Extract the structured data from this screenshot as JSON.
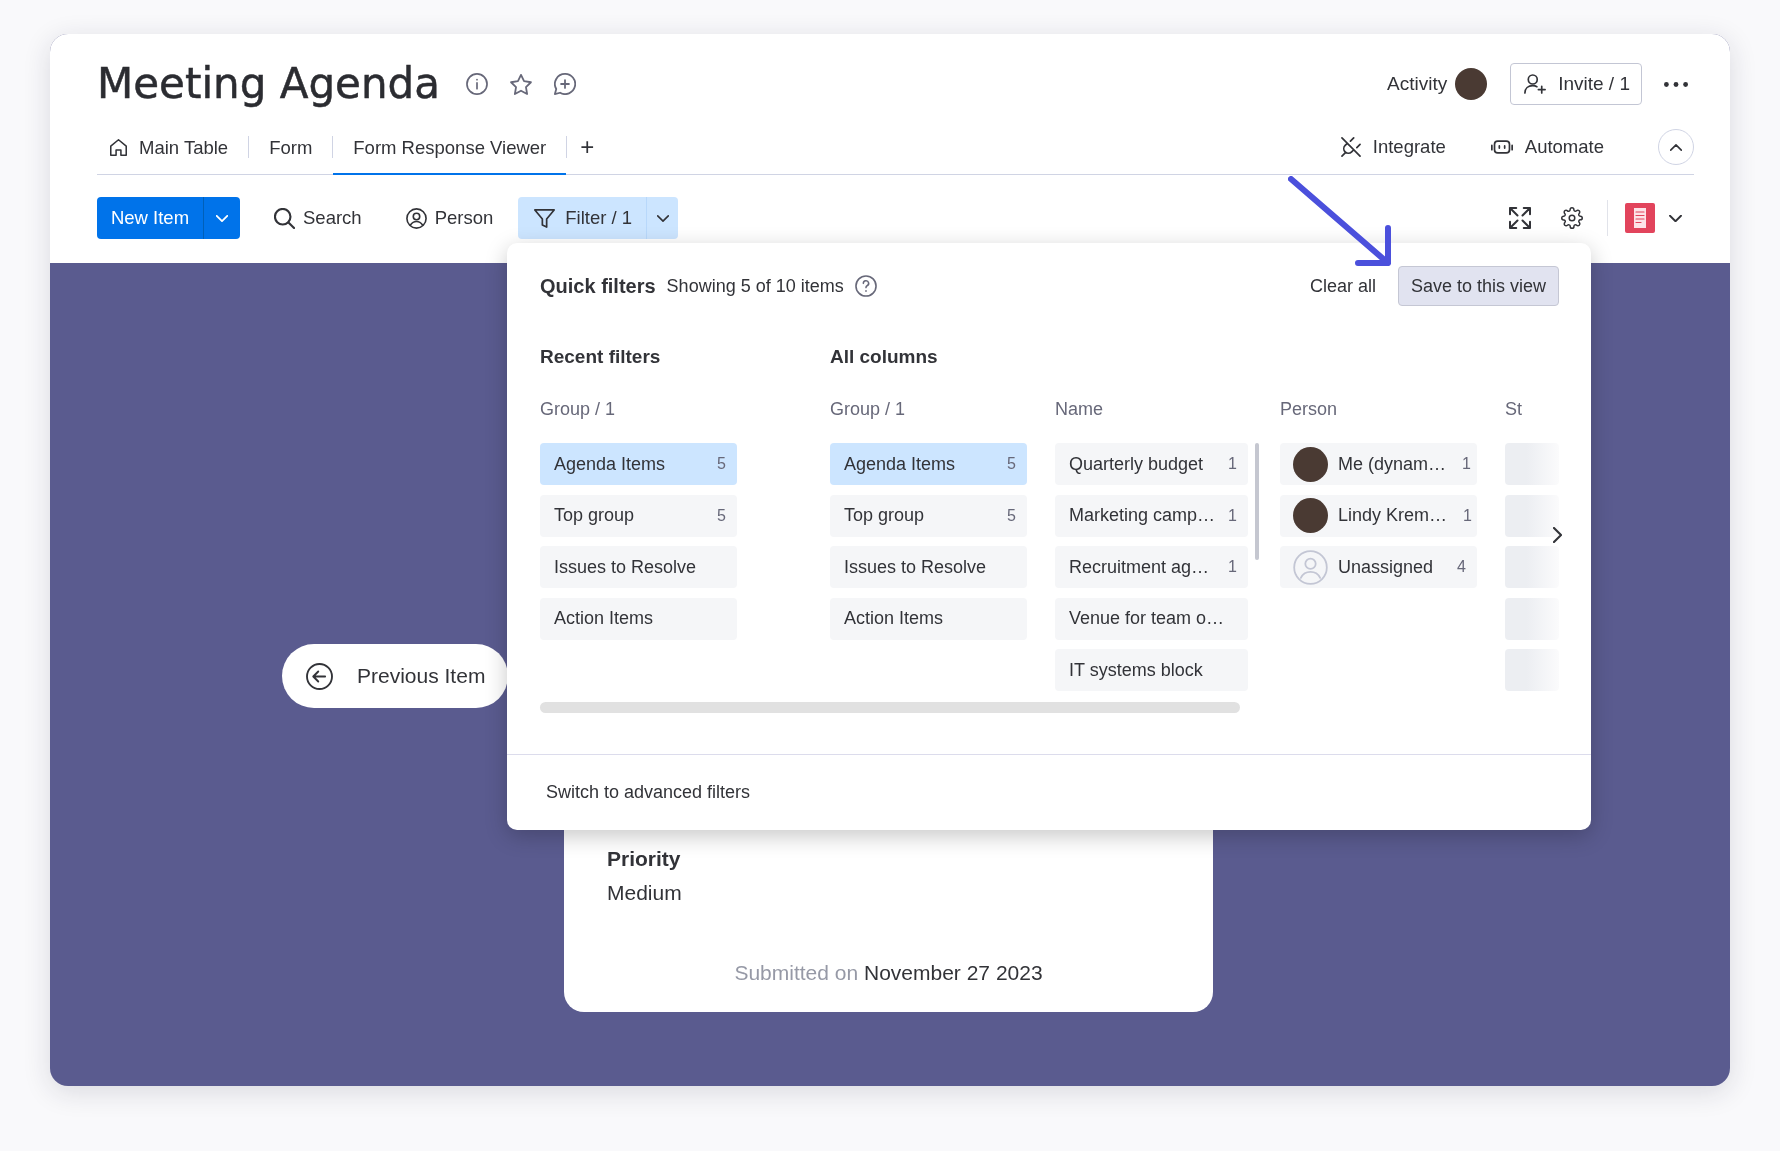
{
  "board": {
    "title": "Meeting Agenda"
  },
  "header": {
    "activity": "Activity",
    "invite": "Invite / 1"
  },
  "tabs": [
    {
      "label": "Main Table",
      "kind": "home",
      "selected": false
    },
    {
      "label": "Form",
      "kind": "plain",
      "selected": false
    },
    {
      "label": "Form Response Viewer",
      "kind": "plain",
      "selected": true
    }
  ],
  "add_view": "+",
  "view_actions": [
    {
      "label": "Integrate",
      "kind": "integrate"
    },
    {
      "label": "Automate",
      "kind": "automate"
    }
  ],
  "toolbar": {
    "new_item": "New Item",
    "search": "Search",
    "person": "Person",
    "filter": {
      "label": "Filter / 1",
      "active": true
    }
  },
  "quick_filters": {
    "title": "Quick filters",
    "summary": "Showing 5 of 10 items",
    "clear_all": "Clear all",
    "save": "Save to this view",
    "sections": [
      {
        "title": "Recent filters",
        "columns": [
          {
            "header": "Group / 1",
            "kind": "group",
            "options": [
              {
                "label": "Agenda Items",
                "count": "5",
                "selected": true
              },
              {
                "label": "Top group",
                "count": "5",
                "selected": false
              },
              {
                "label": "Issues to Resolve",
                "selected": false
              },
              {
                "label": "Action Items",
                "selected": false
              }
            ]
          }
        ]
      },
      {
        "title": "All columns",
        "columns": [
          {
            "header": "Group / 1",
            "kind": "group",
            "options": [
              {
                "label": "Agenda Items",
                "count": "5",
                "selected": true
              },
              {
                "label": "Top group",
                "count": "5",
                "selected": false
              },
              {
                "label": "Issues to Resolve",
                "selected": false
              },
              {
                "label": "Action Items",
                "selected": false
              }
            ]
          },
          {
            "header": "Name",
            "kind": "name",
            "options": [
              {
                "label": "Quarterly budget",
                "count": "1",
                "selected": false
              },
              {
                "label": "Marketing camp…",
                "count": "1",
                "selected": false
              },
              {
                "label": "Recruitment ag…",
                "count": "1",
                "selected": false
              },
              {
                "label": "Venue for team o…",
                "selected": false
              },
              {
                "label": "IT systems block",
                "selected": false
              }
            ]
          },
          {
            "header": "Person",
            "kind": "person",
            "options": [
              {
                "label": "Me (dynam…",
                "count": "1",
                "kind": "avatar",
                "selected": false
              },
              {
                "label": "Lindy Krem…",
                "count": "1",
                "kind": "avatar",
                "selected": false
              },
              {
                "label": "Unassigned",
                "count": "4",
                "kind": "unassigned",
                "selected": false
              }
            ]
          },
          {
            "header": "St",
            "kind": "status",
            "options": [
              {
                "selected": false
              },
              {
                "selected": false
              },
              {
                "selected": false
              },
              {
                "selected": false
              },
              {
                "selected": false
              }
            ]
          }
        ]
      }
    ],
    "advanced": "Switch to advanced filters"
  },
  "previous_item": "Previous Item",
  "form_card": {
    "fields": [
      {
        "label": "Priority",
        "value": "Medium"
      }
    ],
    "submitted_label": "Submitted on",
    "submitted_date": "November 27 2023"
  }
}
